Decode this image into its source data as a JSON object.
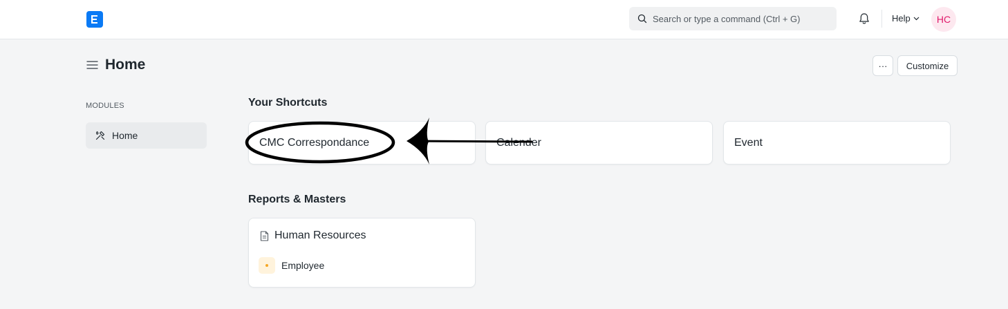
{
  "navbar": {
    "search_placeholder": "Search or type a command (Ctrl + G)",
    "help_label": "Help",
    "avatar_initials": "HC"
  },
  "page": {
    "title": "Home",
    "more_label": "···",
    "customize_label": "Customize"
  },
  "sidebar": {
    "section_label": "MODULES",
    "items": [
      {
        "label": "Home",
        "icon": "tools-icon"
      }
    ]
  },
  "shortcuts": {
    "title": "Your Shortcuts",
    "items": [
      {
        "label": "CMC Correspondance"
      },
      {
        "label": "Calender"
      },
      {
        "label": "Event"
      }
    ]
  },
  "reports": {
    "title": "Reports & Masters",
    "cards": [
      {
        "title": "Human Resources",
        "icon": "document-icon",
        "links": [
          {
            "label": "Employee"
          }
        ]
      }
    ]
  },
  "colors": {
    "brand": "#0a7af5",
    "avatar_bg": "#fde8ef",
    "avatar_text": "#e0196a",
    "annotation": "#000000"
  }
}
